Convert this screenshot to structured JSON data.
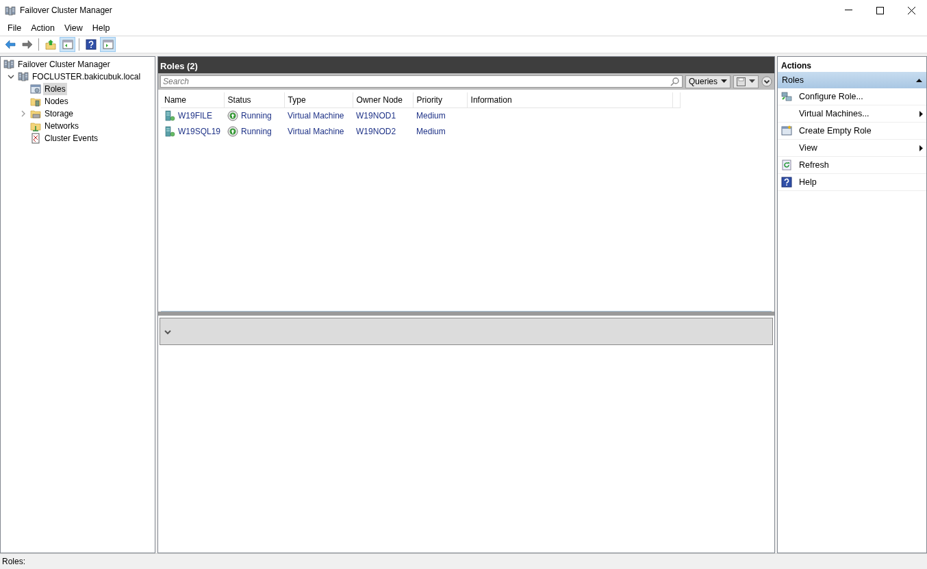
{
  "window": {
    "title": "Failover Cluster Manager"
  },
  "menu": [
    "File",
    "Action",
    "View",
    "Help"
  ],
  "toolbar": [
    {
      "pressed": false
    },
    {
      "pressed": false
    },
    {
      "pressed": false
    },
    {
      "pressed": true
    },
    {
      "pressed": false
    },
    {
      "pressed": true
    }
  ],
  "tree": [
    {
      "label": "Failover Cluster Manager",
      "selected": false,
      "children": [
        {
          "label": "FOCLUSTER.bakicubuk.local",
          "expanded": true,
          "selected": false,
          "children": [
            {
              "label": "Roles",
              "selected": true
            },
            {
              "label": "Nodes",
              "selected": false
            },
            {
              "label": "Storage",
              "expanded": false,
              "selected": false
            },
            {
              "label": "Networks",
              "selected": false
            },
            {
              "label": "Cluster Events",
              "selected": false
            }
          ]
        }
      ]
    }
  ],
  "center": {
    "title": "Roles (2)",
    "search": {
      "placeholder": "Search"
    },
    "queries_button": "Queries",
    "table": {
      "columns": [
        "Name",
        "Status",
        "Type",
        "Owner Node",
        "Priority",
        "Information"
      ],
      "rows": [
        {
          "name": "W19FILE",
          "status": "Running",
          "type": "Virtual Machine",
          "owner_node": "W19NOD1",
          "priority": "Medium"
        },
        {
          "name": "W19SQL19",
          "status": "Running",
          "type": "Virtual Machine",
          "owner_node": "W19NOD2",
          "priority": "Medium"
        }
      ]
    },
    "details_expanded": false
  },
  "actions": {
    "title": "Actions",
    "section": {
      "label": "Roles",
      "expanded": true
    },
    "items": [
      {
        "label": "Configure Role...",
        "submenu": false
      },
      {
        "label": "Virtual Machines...",
        "submenu": true
      },
      {
        "label": "Create Empty Role",
        "submenu": false
      },
      {
        "label": "View",
        "submenu": true
      },
      {
        "label": "Refresh",
        "submenu": false
      },
      {
        "label": "Help",
        "submenu": false
      }
    ]
  },
  "status_bar": "Roles:"
}
